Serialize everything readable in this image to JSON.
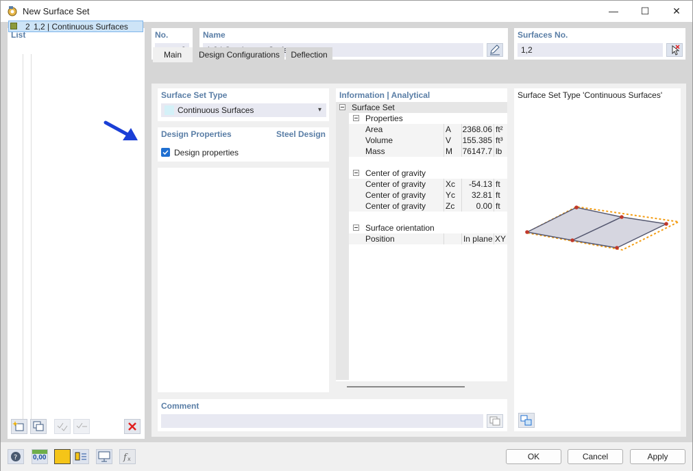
{
  "window": {
    "title": "New Surface Set",
    "minimize": "—",
    "maximize": "☐",
    "close": "✕"
  },
  "list": {
    "header": "List",
    "items": [
      {
        "no": "2",
        "label": "1,2 | Continuous Surfaces",
        "color": "#8c9a3c"
      }
    ]
  },
  "no": {
    "header": "No.",
    "value": "2"
  },
  "name": {
    "header": "Name",
    "value": "1,2 | Continuous Surfaces"
  },
  "surfaces": {
    "header": "Surfaces No.",
    "value": "1,2"
  },
  "tabs": [
    {
      "label": "Main"
    },
    {
      "label": "Design Configurations"
    },
    {
      "label": "Deflection"
    }
  ],
  "surface_set_type": {
    "header": "Surface Set Type",
    "value": "Continuous Surfaces",
    "swatch": "#d4f1f8"
  },
  "design_properties": {
    "header": "Design Properties",
    "right": "Steel Design",
    "checkbox_label": "Design properties",
    "checked": true
  },
  "info": {
    "header": "Information | Analytical",
    "root": "Surface Set",
    "groups": [
      {
        "label": "Properties",
        "rows": [
          {
            "name": "Area",
            "sym": "A",
            "val": "2368.06",
            "unit": "ft²"
          },
          {
            "name": "Volume",
            "sym": "V",
            "val": "155.385",
            "unit": "ft³"
          },
          {
            "name": "Mass",
            "sym": "M",
            "val": "76147.7",
            "unit": "lb"
          }
        ]
      },
      {
        "label": "Center of gravity",
        "rows": [
          {
            "name": "Center of gravity",
            "sym": "Xc",
            "val": "-54.13",
            "unit": "ft"
          },
          {
            "name": "Center of gravity",
            "sym": "Yc",
            "val": "32.81",
            "unit": "ft"
          },
          {
            "name": "Center of gravity",
            "sym": "Zc",
            "val": "0.00",
            "unit": "ft"
          }
        ]
      },
      {
        "label": "Surface orientation",
        "rows": [
          {
            "name": "Position",
            "sym": "",
            "val": "In plane XY",
            "unit": ""
          }
        ]
      }
    ]
  },
  "preview": {
    "title": "Surface Set Type 'Continuous Surfaces'"
  },
  "comment": {
    "header": "Comment",
    "value": ""
  },
  "buttons": {
    "ok": "OK",
    "cancel": "Cancel",
    "apply": "Apply"
  },
  "bottom_tools": {
    "units_label": "0,00"
  },
  "colors": {
    "accent": "#5a7ea6",
    "highlight_outline": "#f39c12",
    "node": "#c0392b",
    "delete": "#e02020",
    "arrow": "#1a3fd6"
  }
}
